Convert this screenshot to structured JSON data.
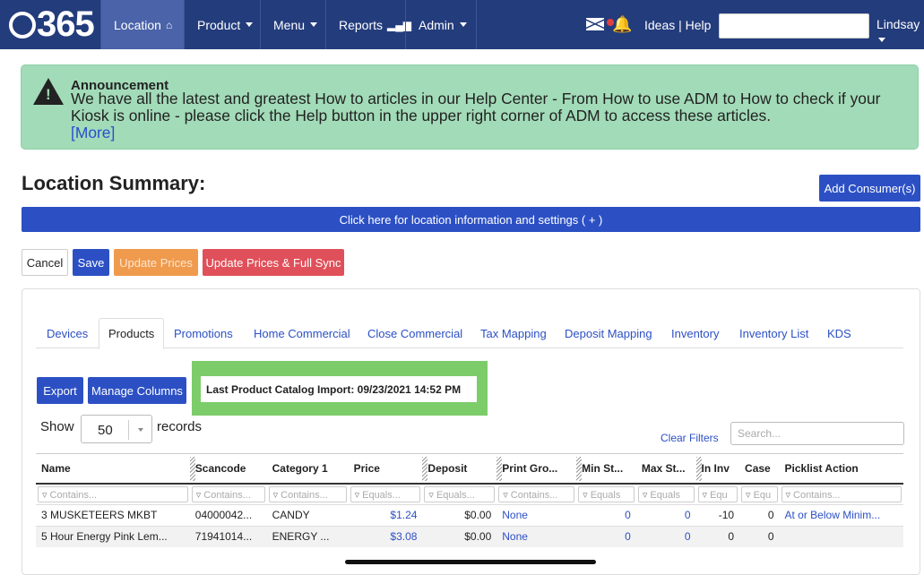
{
  "nav": {
    "logo_text": "365",
    "items": [
      {
        "label": "Location",
        "icon": "home-icon"
      },
      {
        "label": "Product"
      },
      {
        "label": "Menu"
      },
      {
        "label": "Reports",
        "icon": "bar-chart-icon"
      },
      {
        "label": "Admin"
      }
    ],
    "ideas_help": "Ideas | Help",
    "user": "Lindsay"
  },
  "announcement": {
    "title": "Announcement",
    "text": "We have all the latest and greatest How to articles in our Help Center - From How to use ADM to How to check if your Kiosk is online - please click the Help button in the upper right corner of ADM to access these articles.",
    "more": "[More]"
  },
  "page": {
    "title": "Location Summary:",
    "add_consumer": "Add Consumer(s)",
    "info_bar": "Click here for location information and settings ( + )"
  },
  "actions": {
    "cancel": "Cancel",
    "save": "Save",
    "update_prices": "Update Prices",
    "update_full": "Update Prices & Full Sync"
  },
  "tabs": [
    "Devices",
    "Products",
    "Promotions",
    "Home Commercial",
    "Close Commercial",
    "Tax Mapping",
    "Deposit Mapping",
    "Inventory",
    "Inventory List",
    "KDS"
  ],
  "toolbar": {
    "export": "Export",
    "manage_columns": "Manage Columns",
    "catalog_import": "Last Product Catalog Import: 09/23/2021 14:52 PM",
    "show": "Show",
    "page_size": "50",
    "records": "records",
    "clear_filters": "Clear Filters",
    "search_placeholder": "Search..."
  },
  "table": {
    "headers": [
      "Name",
      "Scancode",
      "Category 1",
      "Price",
      "Deposit",
      "Print Gro...",
      "Min St...",
      "Max St...",
      "In Inv",
      "Case",
      "Picklist Action"
    ],
    "filters": [
      "Contains...",
      "Contains...",
      "Contains...",
      "Equals...",
      "Equals...",
      "Contains...",
      "Equals",
      "Equals",
      "Equ",
      "Equ",
      "Contains..."
    ],
    "rows": [
      [
        "3 MUSKETEERS MKBT",
        "04000042...",
        "CANDY",
        "$1.24",
        "$0.00",
        "None",
        "0",
        "0",
        "-10",
        "0",
        "At or Below Minim..."
      ],
      [
        "5 Hour Energy Pink Lem...",
        "71941014...",
        "ENERGY ...",
        "$3.08",
        "$0.00",
        "None",
        "0",
        "0",
        "0",
        "0",
        ""
      ]
    ]
  },
  "colors": {
    "nav": "#233c7c",
    "primary": "#2c50c4",
    "orange": "#ef9a4d",
    "red": "#e0505a",
    "announce": "#a2dbb8",
    "highlight": "#7ccd6a"
  }
}
